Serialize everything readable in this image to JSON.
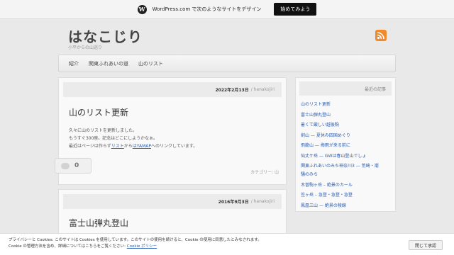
{
  "wpbar": {
    "text": "WordPress.com で次のようなサイトをデザイン",
    "button": "始めてみよう"
  },
  "site": {
    "title": "はなこじり",
    "description": "小平からの山巡り"
  },
  "nav": {
    "items": [
      "紹介",
      "関東ふれあいの道",
      "山のリスト"
    ]
  },
  "posts": [
    {
      "date": "2022年2月13日",
      "author": "/ hanakojiri",
      "title": "山のリスト更新",
      "lines": [
        "久々に山のリストを更新しました。",
        "もうすぐ300座。記念はどこにしようかなぁ。"
      ],
      "line3_prefix": "最近はページは作らず",
      "line3_link1": "リスト",
      "line3_mid": "から",
      "line3_link2": "はYAMAP",
      "line3_suffix": "へのリンクしています。",
      "comment_count": "0",
      "category": "カテゴリー: 山"
    },
    {
      "date": "2016年9月3日",
      "author": "/ hanakojiri",
      "title": "富士山弾丸登山"
    }
  ],
  "sidebar": {
    "widget_title": "最近の記事",
    "items": [
      "山のリスト更新",
      "富士山弾丸登山",
      "暑くて厳しい越後駒",
      "剣山 — 夏休み四国めぐり",
      "飛龍山 — 梅雨が来る前に",
      "仙丈ケ岳 — GWは春山登山でしょ",
      "関東ふれあいのみち神奈川3 — 荒崎・潮",
      "騒のみち",
      "木曽駒ヶ岳 – 絶景のカール",
      "笠ヶ岳 – 急登・急登・急登",
      "鳳凰三山 — 絶景の稜線"
    ]
  },
  "cookie": {
    "line1": "プライバシーと Cookies: このサイトは Cookies を使用しています。このサイトの使用を続けると、Cookie の使用に同意したとみなされます。",
    "line2_text": "Cookie の管理方法を含め、詳細についてはこちらをご覧ください:",
    "line2_link": "Cookie ポリシー",
    "close_button": "閉じて承認"
  },
  "colors": {
    "link": "#2a5db0",
    "rss": "#f0882c",
    "background": "#e9e9e9"
  }
}
